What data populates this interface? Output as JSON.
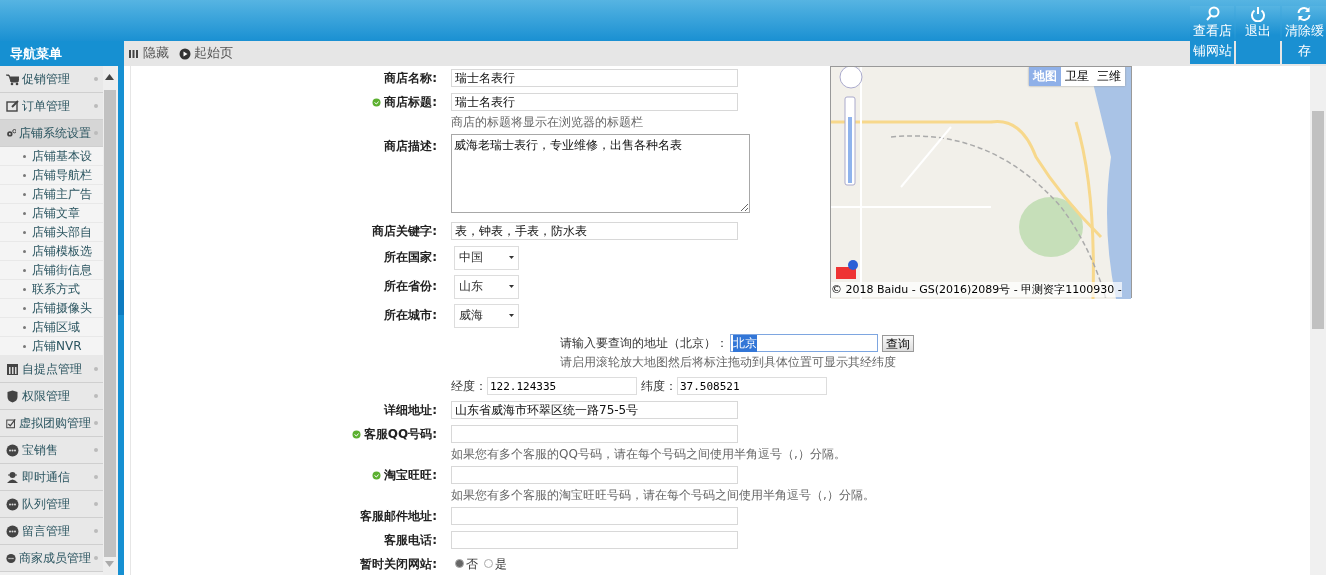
{
  "header": {
    "actions": [
      {
        "label": "查看店铺网站",
        "kind": "search"
      },
      {
        "label": "退出",
        "kind": "power"
      },
      {
        "label": "清除缓存",
        "kind": "refresh"
      }
    ]
  },
  "sidebar": {
    "title": "导航菜单",
    "items": [
      {
        "label": "促销管理",
        "kind": "cart",
        "expanded": false
      },
      {
        "label": "订单管理",
        "kind": "edit",
        "expanded": false
      },
      {
        "label": "店铺系统设置",
        "kind": "gears",
        "expanded": true,
        "children": [
          {
            "label": "店铺基本设"
          },
          {
            "label": "店铺导航栏"
          },
          {
            "label": "店铺主广告"
          },
          {
            "label": "店铺文章"
          },
          {
            "label": "店铺头部自"
          },
          {
            "label": "店铺模板选"
          },
          {
            "label": "店铺街信息"
          },
          {
            "label": "联系方式"
          },
          {
            "label": "店铺摄像头"
          },
          {
            "label": "店铺区域"
          },
          {
            "label": "店铺NVR"
          }
        ]
      },
      {
        "label": "自提点管理",
        "kind": "store",
        "expanded": false
      },
      {
        "label": "权限管理",
        "kind": "shield",
        "expanded": false
      },
      {
        "label": "虚拟团购管理",
        "kind": "check",
        "expanded": false
      },
      {
        "label": "宝销售",
        "kind": "chat",
        "expanded": false
      },
      {
        "label": "即时通信",
        "kind": "user",
        "expanded": false
      },
      {
        "label": "队列管理",
        "kind": "chat",
        "expanded": false
      },
      {
        "label": "留言管理",
        "kind": "chat",
        "expanded": false
      },
      {
        "label": "商家成员管理",
        "kind": "chat",
        "expanded": false
      }
    ]
  },
  "toolbar": [
    {
      "label": "隐藏",
      "kind": "hide"
    },
    {
      "label": "起始页",
      "kind": "home"
    }
  ],
  "form": {
    "upper_fields": [
      {
        "kind": "text",
        "label": "商店名称:",
        "value": "瑞士名表行",
        "required": false
      },
      {
        "kind": "text",
        "label": "商店标题:",
        "value": "瑞士名表行",
        "required": true,
        "hint": "商店的标题将显示在浏览器的标题栏"
      },
      {
        "kind": "textarea",
        "label": "商店描述:",
        "value": "威海老瑞士表行，专业维修，出售各种名表",
        "required": false
      },
      {
        "kind": "text",
        "label": "商店关键字:",
        "value": "表，钟表，手表，防水表",
        "required": false
      },
      {
        "kind": "select",
        "label": "所在国家:",
        "value": "中国",
        "required": false
      },
      {
        "kind": "select",
        "label": "所在省份:",
        "value": "山东",
        "required": false
      },
      {
        "kind": "select",
        "label": "所在城市:",
        "value": "威海",
        "required": false
      }
    ],
    "map": {
      "view_buttons": [
        {
          "label": "地图",
          "selected": true
        },
        {
          "label": "卫星",
          "selected": false
        },
        {
          "label": "三维",
          "selected": false
        }
      ],
      "copyright": "© 2018 Baidu - GS(2016)2089号 - 甲测资字1100930 -"
    },
    "address_search": {
      "label": "请输入要查询的地址（北京）：",
      "value": "北京",
      "button": "查询",
      "hint": "请启用滚轮放大地图然后将标注拖动到具体位置可显示其经纬度"
    },
    "coordinates": {
      "longitude_label": "经度：",
      "longitude": "122.124335",
      "latitude_label": "纬度：",
      "latitude": "37.508521"
    },
    "lower_fields": [
      {
        "kind": "text",
        "label": "详细地址:",
        "value": "山东省威海市环翠区统一路75-5号",
        "required": false
      },
      {
        "kind": "text",
        "label": "客服QQ号码:",
        "required": true,
        "hint": "如果您有多个客服的QQ号码，请在每个号码之间使用半角逗号（,）分隔。"
      },
      {
        "kind": "text",
        "label": "淘宝旺旺:",
        "required": true,
        "hint": "如果您有多个客服的淘宝旺旺号码，请在每个号码之间使用半角逗号（,）分隔。"
      },
      {
        "kind": "text",
        "label": "客服邮件地址:",
        "required": false
      },
      {
        "kind": "text",
        "label": "客服电话:",
        "required": false
      },
      {
        "kind": "radio",
        "label": "暂时关闭网站:",
        "required": false,
        "options": [
          {
            "label": "否",
            "selected": true
          },
          {
            "label": "是",
            "selected": false
          }
        ]
      }
    ]
  }
}
